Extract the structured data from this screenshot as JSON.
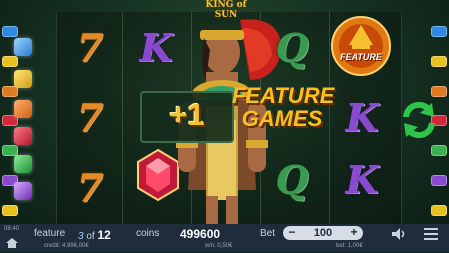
{
  "game": {
    "logo_text": "KING of SUN"
  },
  "reels": {
    "col1": [
      "7",
      "7",
      "7"
    ],
    "col2": [
      "K"
    ],
    "col4": [
      "Q",
      "Q"
    ],
    "col5": [
      "K",
      "K"
    ]
  },
  "feature_medal": {
    "label": "FEATURE"
  },
  "banner": {
    "plus": "+1",
    "line1": "FEATURE",
    "line2": "GAMES"
  },
  "status_bar": {
    "small_label": "08:40",
    "feature_label": "feature",
    "feature_current": "3",
    "feature_of": "of",
    "feature_total": "12",
    "coins_label": "coins",
    "coins_value": "499600",
    "bet_label": "Bet",
    "bet_value": "100",
    "bet_minus": "−",
    "bet_plus": "+",
    "credit_label": "credit: 4.996,00€",
    "win_label": "win: 0,50€",
    "bet_money_label": "bet: 1,00€"
  },
  "colors": {
    "status_bar_bg": "#1f2c3c",
    "accent_gold": "#f5c020",
    "refresh_green": "#2ec64a"
  },
  "icons": {
    "refresh": "refresh-icon",
    "sound": "sound-icon",
    "menu": "menu-icon"
  }
}
